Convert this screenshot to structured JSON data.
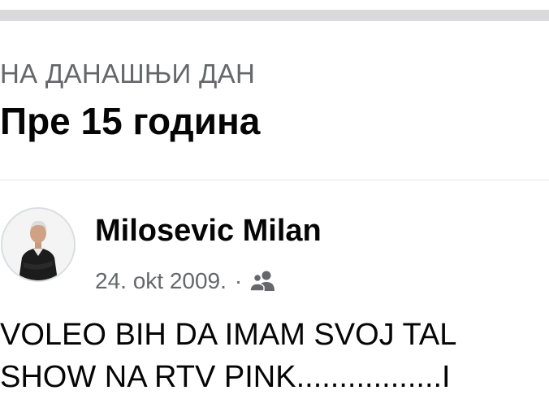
{
  "memory": {
    "section_label": "НА ДАНАШЊИ ДАН",
    "years_ago": "Пре 15 година"
  },
  "post": {
    "author": "Milosevic Milan",
    "date": "24. okt 2009.",
    "separator": "·",
    "audience_icon": "friends-icon",
    "text_lines": [
      "VOLEO BIH DA IMAM SVOJ TAL",
      "SHOW NA RTV PINK.................I"
    ]
  },
  "colors": {
    "primary_text": "#050505",
    "secondary_text": "#65676b",
    "top_bar": "#d9dadc",
    "divider": "#e4e6eb"
  }
}
